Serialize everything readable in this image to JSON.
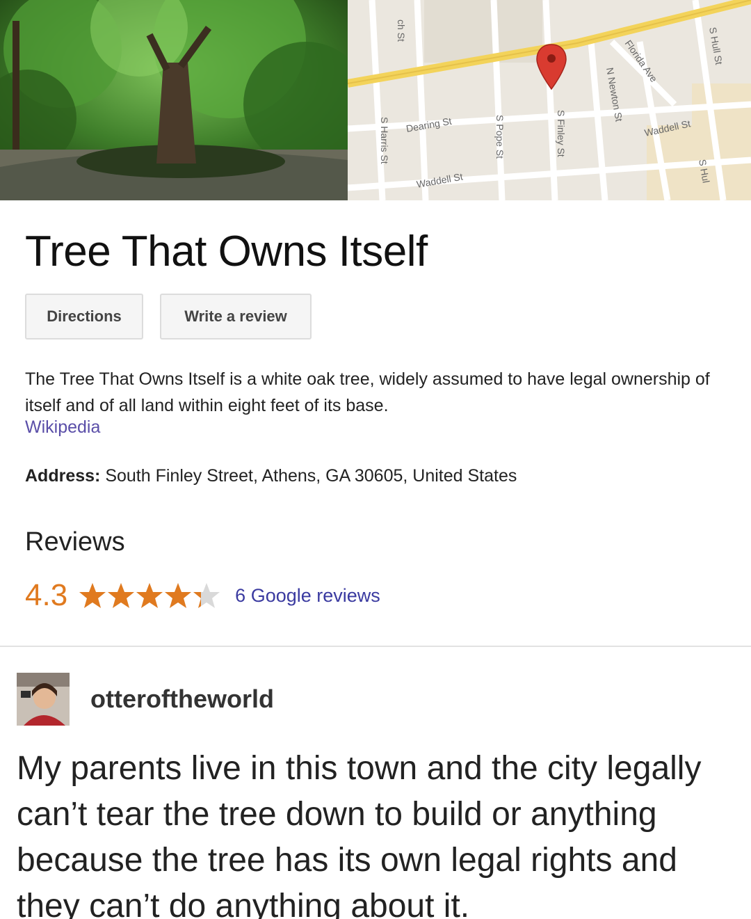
{
  "place": {
    "title": "Tree That Owns Itself",
    "buttons": {
      "directions": "Directions",
      "write_review": "Write a review"
    },
    "description": "The Tree That Owns Itself is a white oak tree, widely assumed to have legal ownership of itself and of all land within eight feet of its base.",
    "source": "Wikipedia",
    "address_label": "Address:",
    "address": "South Finley Street, Athens, GA 30605, United States",
    "reviews_heading": "Reviews",
    "rating": "4.3",
    "rating_value": 4.3,
    "rating_max": 5,
    "review_count": "6 Google reviews"
  },
  "map": {
    "streets": {
      "ch_st": "ch St",
      "dearing_st": "Dearing St",
      "waddell_st_left": "Waddell St",
      "s_harris_st": "S Harris St",
      "s_pope_st": "S Pope St",
      "s_finley_st": "S Finley St",
      "n_newton_st": "N Newton St",
      "florida_ave": "Florida Ave",
      "waddell_st_right": "Waddell St",
      "s_hull_st_top": "S Hull St",
      "s_hull_st_bottom": "S Hul"
    }
  },
  "post": {
    "username": "otteroftheworld",
    "body": "My parents live in this town and the city legally can’t tear the tree down to build or anything because the tree has its own legal rights and they can’t do anything about it."
  },
  "colors": {
    "rating_orange": "#e07a1f",
    "link_blue": "#3a3aa0",
    "source_purple": "#5a4ea8",
    "map_road_yellow": "#f3d35a",
    "pin_red": "#d93b30"
  },
  "icons": [
    "star-icon",
    "half-star-icon",
    "map-pin-icon"
  ]
}
